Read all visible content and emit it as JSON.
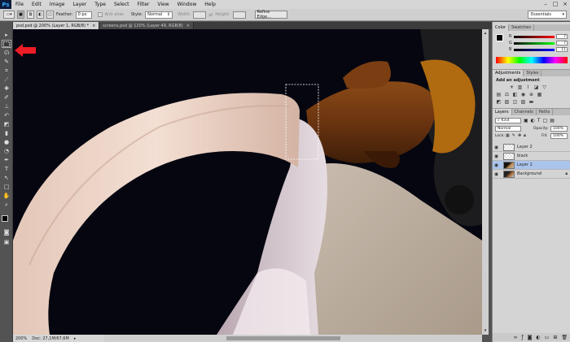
{
  "menubar": {
    "logo": "Ps",
    "items": [
      "File",
      "Edit",
      "Image",
      "Layer",
      "Type",
      "Select",
      "Filter",
      "View",
      "Window",
      "Help"
    ],
    "window_controls": [
      "–",
      "□",
      "×"
    ]
  },
  "options": {
    "feather_label": "Feather:",
    "feather_value": "0 px",
    "antialias_label": "Anti-alias",
    "style_label": "Style:",
    "style_value": "Normal",
    "width_label": "Width:",
    "height_label": "Height:",
    "refine_edge": "Refine Edge...",
    "workspace": "Essentials"
  },
  "tabs": [
    {
      "label": "psd.psd @ 200% (Layer 1, RGB/8) *",
      "active": true
    },
    {
      "label": "screens.psd @ 120% (Layer 49, RGB/8)",
      "active": false
    }
  ],
  "status": {
    "zoom": "200%",
    "doc": "Doc: 27,1M/67,6M"
  },
  "color_panel": {
    "tabs": [
      "Color",
      "Swatches"
    ],
    "rows": [
      {
        "label": "R",
        "value": "7"
      },
      {
        "label": "G",
        "value": "7"
      },
      {
        "label": "B",
        "value": "11"
      }
    ],
    "foreground": "#07070b"
  },
  "adjustments_panel": {
    "tabs": [
      "Adjustments",
      "Styles"
    ],
    "title": "Add an adjustment"
  },
  "layers_panel": {
    "tabs": [
      "Layers",
      "Channels",
      "Paths"
    ],
    "kind": "Kind",
    "blend_mode": "Normal",
    "opacity_label": "Opacity:",
    "opacity_value": "100%",
    "lock_label": "Lock:",
    "fill_label": "Fill:",
    "fill_value": "100%",
    "layers": [
      {
        "name": "Layer 2",
        "selected": false
      },
      {
        "name": "black",
        "selected": false
      },
      {
        "name": "Layer 1",
        "selected": true
      },
      {
        "name": "Background",
        "selected": false
      }
    ]
  },
  "colors": {
    "accent_arrow": "#ee1c25",
    "selected_layer": "#aac4ec"
  }
}
